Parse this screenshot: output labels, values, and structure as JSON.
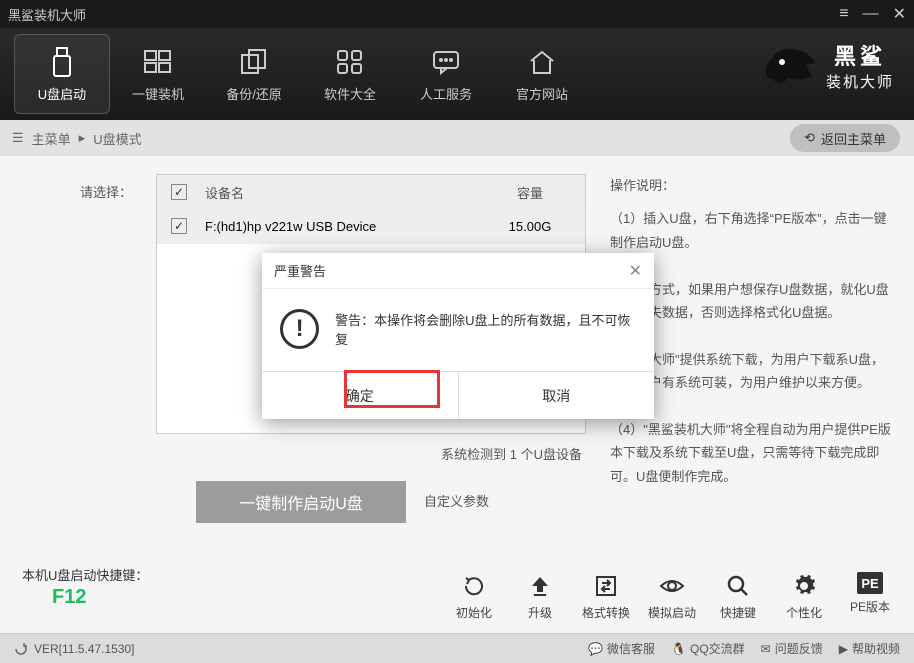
{
  "app": {
    "title": "黑鲨装机大师"
  },
  "window_controls": {
    "menu": "≡",
    "min": "—",
    "close": "✕"
  },
  "brand": {
    "line1": "黑鲨",
    "line2": "装机大师"
  },
  "nav": [
    {
      "label": "U盘启动",
      "icon": "usb-icon",
      "active": true
    },
    {
      "label": "一键装机",
      "icon": "windows-icon"
    },
    {
      "label": "备份/还原",
      "icon": "copy-icon"
    },
    {
      "label": "软件大全",
      "icon": "apps-icon"
    },
    {
      "label": "人工服务",
      "icon": "chat-icon"
    },
    {
      "label": "官方网站",
      "icon": "home-icon"
    }
  ],
  "breadcrumb": {
    "main": "主菜单",
    "sub": "U盘模式",
    "back": "返回主菜单"
  },
  "left": {
    "choose_label": "请选择："
  },
  "table": {
    "headers": {
      "name": "设备名",
      "capacity": "容量"
    },
    "rows": [
      {
        "name": "F:(hd1)hp v221w USB Device",
        "capacity": "15.00G",
        "checked": true
      }
    ]
  },
  "detect": "系统检测到 1 个U盘设备",
  "big_button": "一键制作启动U盘",
  "custom_params": "自定义参数",
  "right": {
    "title": "操作说明：",
    "p1": "（1）插入U盘，右下角选择“PE版本”，点击一键制作启动U盘。",
    "p2": "格式化方式，如果用户想保存U盘数据，就化U盘且不丢失数据，否则选择格式化U盘据。",
    "p3": "鲨装机大师\"提供系统下载，为用户下载系U盘，保证用户有系统可装，为用户维护以来方便。",
    "p4": "（4）\"黑鲨装机大师\"将全程自动为用户提供PE版本下载及系统下载至U盘，只需等待下载完成即可。U盘便制作完成。"
  },
  "hotkey": {
    "label": "本机U盘启动快捷键：",
    "key": "F12"
  },
  "tools": [
    {
      "label": "初始化",
      "icon": "reset-icon"
    },
    {
      "label": "升级",
      "icon": "upgrade-icon"
    },
    {
      "label": "格式转换",
      "icon": "convert-icon"
    },
    {
      "label": "模拟启动",
      "icon": "eye-icon"
    },
    {
      "label": "快捷键",
      "icon": "search-icon"
    },
    {
      "label": "个性化",
      "icon": "gear-icon"
    },
    {
      "label": "PE版本",
      "icon": "pe-icon",
      "text": "PE"
    }
  ],
  "status": {
    "version": "VER[11.5.47.1530]",
    "links": {
      "wechat": "微信客服",
      "qq": "QQ交流群",
      "feedback": "问题反馈",
      "help": "帮助视频"
    }
  },
  "dialog": {
    "title": "严重警告",
    "message": "警告：本操作将会删除U盘上的所有数据，且不可恢复",
    "ok": "确定",
    "cancel": "取消"
  }
}
